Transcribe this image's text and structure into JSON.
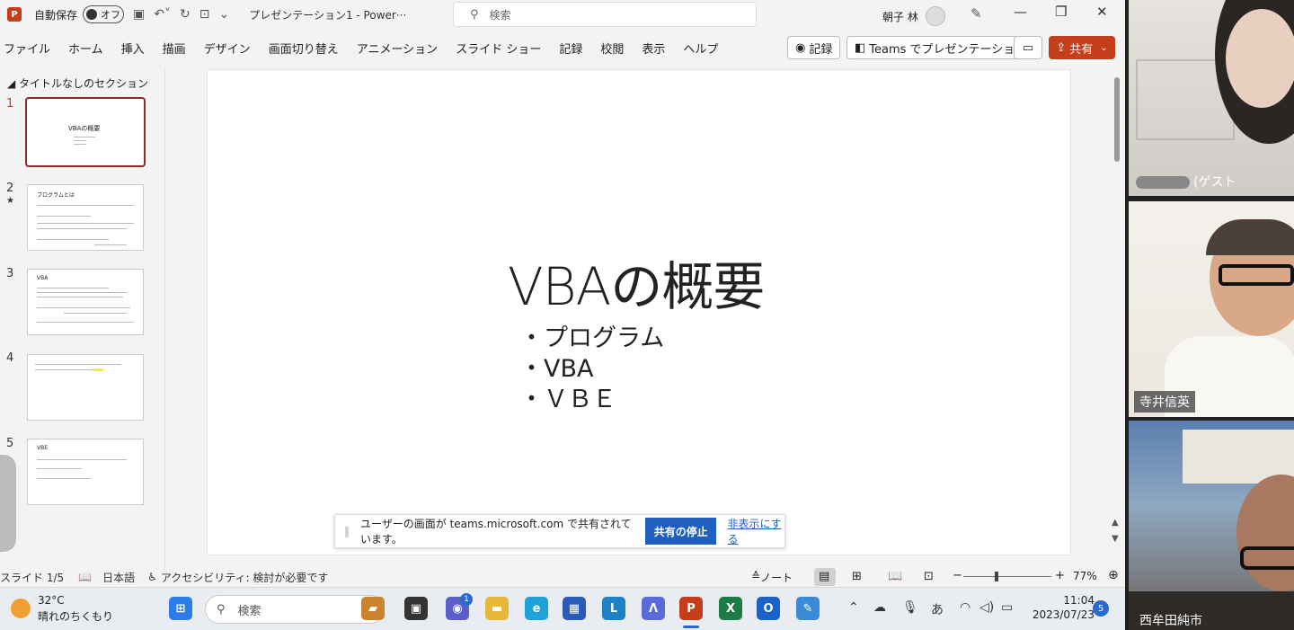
{
  "titlebar": {
    "app_logo": "P",
    "autosave_label": "自動保存",
    "autosave_state": "オフ",
    "doc_title": "プレゼンテーション1  -  Power···",
    "search_placeholder": "検索",
    "user_name": "朝子 林"
  },
  "ribbon": {
    "tabs": [
      "ファイル",
      "ホーム",
      "挿入",
      "描画",
      "デザイン",
      "画面切り替え",
      "アニメーション",
      "スライド ショー",
      "記録",
      "校閲",
      "表示",
      "ヘルプ"
    ],
    "record_button": "記録",
    "teams_button": "Teams でプレゼンテーション",
    "share_button": "共有"
  },
  "thumbnails": {
    "section_title": "タイトルなしのセクション",
    "slides": [
      {
        "number": "1",
        "title": "VBAの概要",
        "active": true
      },
      {
        "number": "2",
        "title": "プログラムとは",
        "active": false,
        "star": "★"
      },
      {
        "number": "3",
        "title": "VBA",
        "active": false
      },
      {
        "number": "4",
        "title": "",
        "active": false
      },
      {
        "number": "5",
        "title": "VBE",
        "active": false
      }
    ]
  },
  "slide": {
    "title": "VBAの概要",
    "bullets": [
      "・プログラム",
      "・VBA",
      "・ＶＢＥ"
    ]
  },
  "share_notice": {
    "text": "ユーザーの画面が teams.microsoft.com で共有されています。",
    "stop_button": "共有の停止",
    "hide_link": "非表示にする"
  },
  "statusbar": {
    "slide_indicator": "スライド 1/5",
    "language": "日本語",
    "accessibility": "アクセシビリティ: 検討が必要です",
    "notes": "ノート",
    "zoom": "77%"
  },
  "taskbar": {
    "temperature": "32°C",
    "weather": "晴れのちくもり",
    "search_placeholder": "検索",
    "teams_badge": "1",
    "ime": "あ",
    "time": "11:04",
    "date": "2023/07/23",
    "notification_count": "5"
  },
  "participants": [
    {
      "name": "(ゲスト"
    },
    {
      "name": "寺井信英"
    },
    {
      "name": "西牟田純市"
    }
  ],
  "colors": {
    "accent": "#c43e1c",
    "share_stop": "#1f5fbf"
  }
}
